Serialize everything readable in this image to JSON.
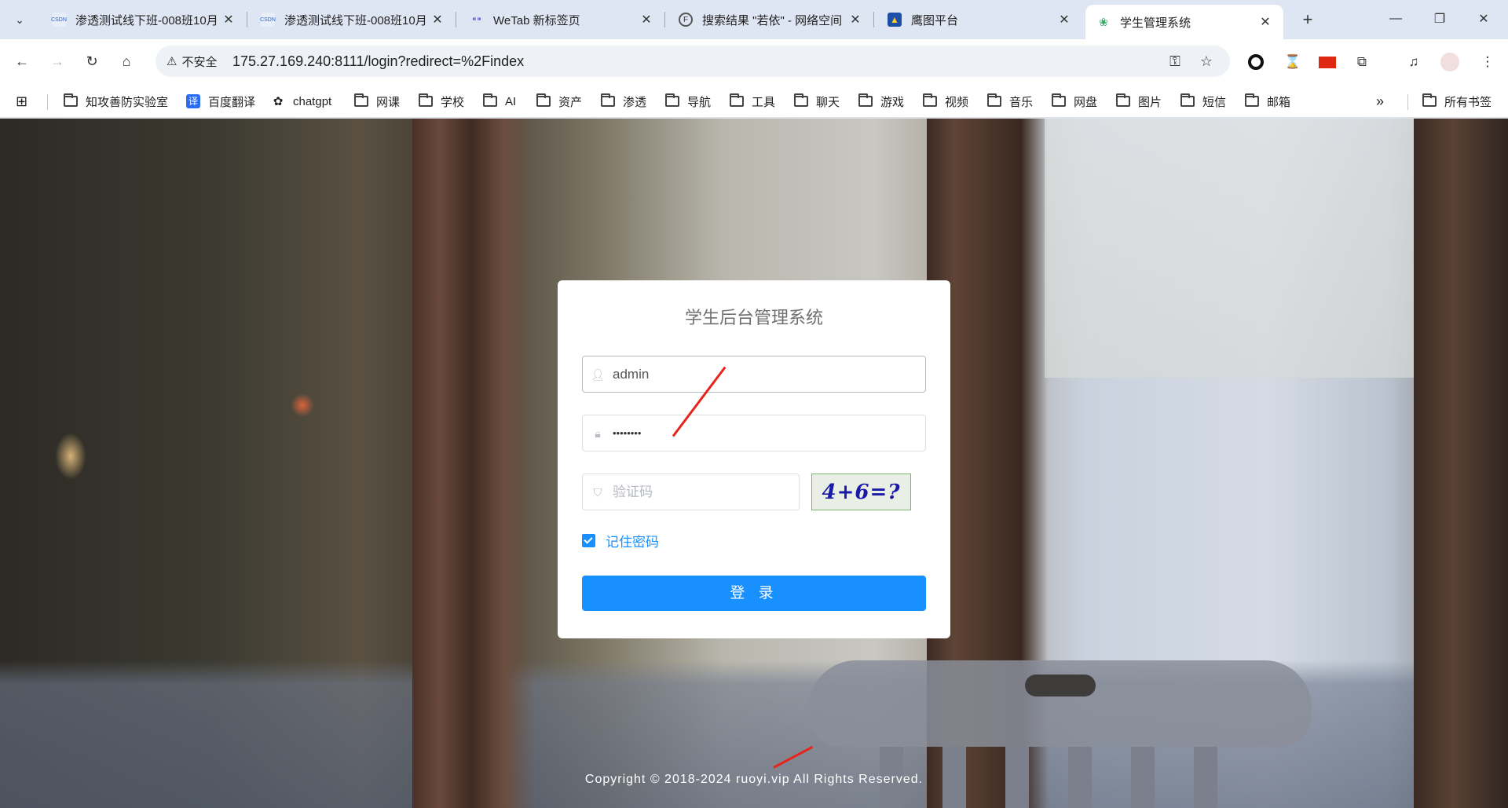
{
  "tabs": [
    {
      "title": "渗透测试线下班-008班10月",
      "favicon": "csdn-icon"
    },
    {
      "title": "渗透测试线下班-008班10月",
      "favicon": "csdn-icon"
    },
    {
      "title": "WeTab 新标签页",
      "favicon": "wetab-icon"
    },
    {
      "title": "搜索结果 \"若依\" - 网络空间",
      "favicon": "fofa-icon"
    },
    {
      "title": "鹰图平台",
      "favicon": "hunter-icon"
    },
    {
      "title": "学生管理系统",
      "favicon": "ruoyi-icon"
    }
  ],
  "address_bar": {
    "security_label": "不安全",
    "url": "175.27.169.240:8111/login?redirect=%2Findex"
  },
  "bookmarks": [
    {
      "label": "知攻善防实验室",
      "icon": "folder-icon"
    },
    {
      "label": "百度翻译",
      "icon": "baidu-translate-icon"
    },
    {
      "label": "chatgpt",
      "icon": "openai-icon"
    },
    {
      "label": "网课",
      "icon": "folder-icon"
    },
    {
      "label": "学校",
      "icon": "folder-icon"
    },
    {
      "label": "AI",
      "icon": "folder-icon"
    },
    {
      "label": "资产",
      "icon": "folder-icon"
    },
    {
      "label": "渗透",
      "icon": "folder-icon"
    },
    {
      "label": "导航",
      "icon": "folder-icon"
    },
    {
      "label": "工具",
      "icon": "folder-icon"
    },
    {
      "label": "聊天",
      "icon": "folder-icon"
    },
    {
      "label": "游戏",
      "icon": "folder-icon"
    },
    {
      "label": "视频",
      "icon": "folder-icon"
    },
    {
      "label": "音乐",
      "icon": "folder-icon"
    },
    {
      "label": "网盘",
      "icon": "folder-icon"
    },
    {
      "label": "图片",
      "icon": "folder-icon"
    },
    {
      "label": "短信",
      "icon": "folder-icon"
    },
    {
      "label": "邮箱",
      "icon": "folder-icon"
    }
  ],
  "all_bookmarks_label": "所有书签",
  "login": {
    "title": "学生后台管理系统",
    "username_value": "admin",
    "password_value": "••••••••",
    "captcha_placeholder": "验证码",
    "captcha_image_text": "4+6=?",
    "remember_label": "记住密码",
    "remember_checked": true,
    "submit_label": "登 录"
  },
  "footer": {
    "copyright": "Copyright © 2018-2024 ruoyi.vip All Rights Reserved."
  },
  "colors": {
    "primary": "#1890ff",
    "annotation_arrow": "#e8231b"
  }
}
